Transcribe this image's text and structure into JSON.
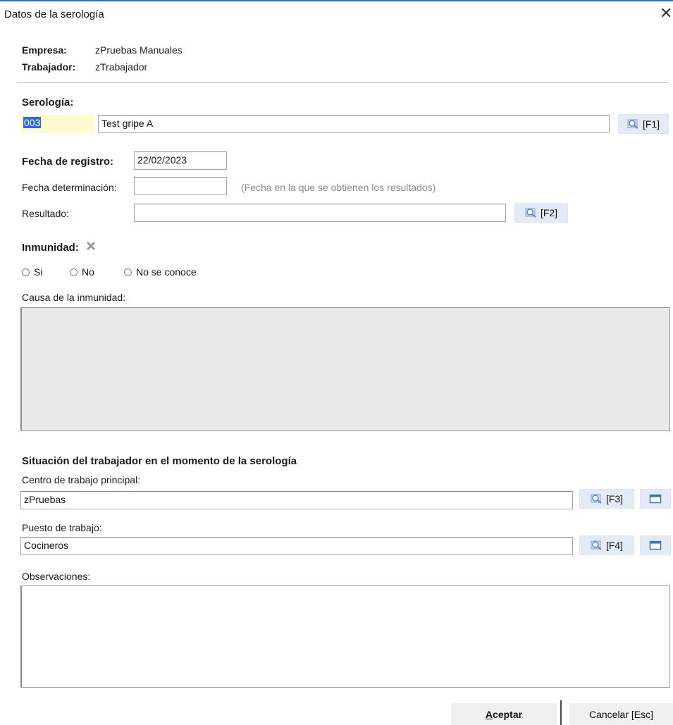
{
  "window": {
    "title": "Datos de la serología",
    "close_glyph": "✕"
  },
  "header": {
    "empresa_label": "Empresa:",
    "empresa_value": "zPruebas Manuales",
    "trabajador_label": "Trabajador:",
    "trabajador_value": "zTrabajador"
  },
  "serologia": {
    "label": "Serología:",
    "code": "003",
    "name": "Test gripe A",
    "lookup_label": "[F1]"
  },
  "fecha_registro": {
    "label": "Fecha de registro:",
    "value": "22/02/2023"
  },
  "fecha_determinacion": {
    "label": "Fecha determinación:",
    "value": "",
    "hint": "(Fecha en la que se obtienen los resultados)"
  },
  "resultado": {
    "label": "Resultado:",
    "value": "",
    "lookup_label": "[F2]"
  },
  "inmunidad": {
    "label": "Inmunidad:",
    "clear_icon": "clear-x-icon",
    "options": [
      "Si",
      "No",
      "No se conoce"
    ],
    "causa_label": "Causa de la inmunidad:",
    "causa_value": ""
  },
  "situacion": {
    "heading": "Situación del trabajador en el momento de la serología",
    "centro_label": "Centro de trabajo principal:",
    "centro_value": "zPruebas",
    "centro_lookup_label": "[F3]",
    "puesto_label": "Puesto de trabajo:",
    "puesto_value": "Cocineros",
    "puesto_lookup_label": "[F4]"
  },
  "observaciones": {
    "label": "Observaciones:",
    "value": ""
  },
  "footer": {
    "accept_label": "Aceptar",
    "accept_mnemonic": "A",
    "accept_rest": "ceptar",
    "cancel_label": "Cancelar [Esc]"
  },
  "colors": {
    "accent": "#2b6cc4",
    "button_bg": "#e3ebf6",
    "code_bg": "#fffbd0",
    "selection": "#2e67d8"
  }
}
